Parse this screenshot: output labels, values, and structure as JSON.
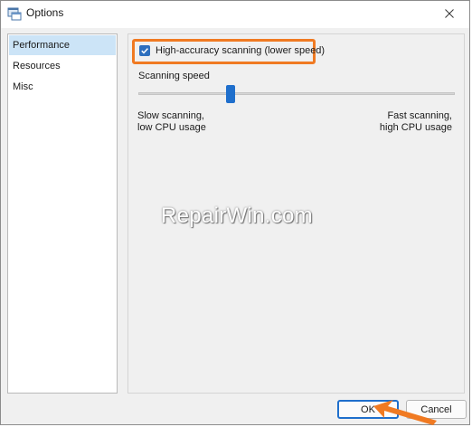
{
  "window": {
    "title": "Options"
  },
  "sidebar": {
    "items": [
      {
        "label": "Performance",
        "selected": true
      },
      {
        "label": "Resources",
        "selected": false
      },
      {
        "label": "Misc",
        "selected": false
      }
    ]
  },
  "performance": {
    "checkbox_label": "High-accuracy scanning (lower speed)",
    "checkbox_checked": true,
    "speed_label": "Scanning speed",
    "slider_value_fraction": 0.29,
    "slow_label_line1": "Slow scanning,",
    "slow_label_line2": "low CPU usage",
    "fast_label_line1": "Fast scanning,",
    "fast_label_line2": "high CPU usage"
  },
  "watermark": "RepairWin.com",
  "buttons": {
    "ok_label": "OK",
    "cancel_label": "Cancel"
  },
  "colors": {
    "highlight": "#f07a22",
    "accent": "#1f6fcc",
    "selected_bg": "#cce4f7"
  },
  "icons": {
    "app": "app-window-icon",
    "close": "close-icon",
    "check": "checkmark-icon",
    "pointer": "arrow-pointer-icon"
  }
}
